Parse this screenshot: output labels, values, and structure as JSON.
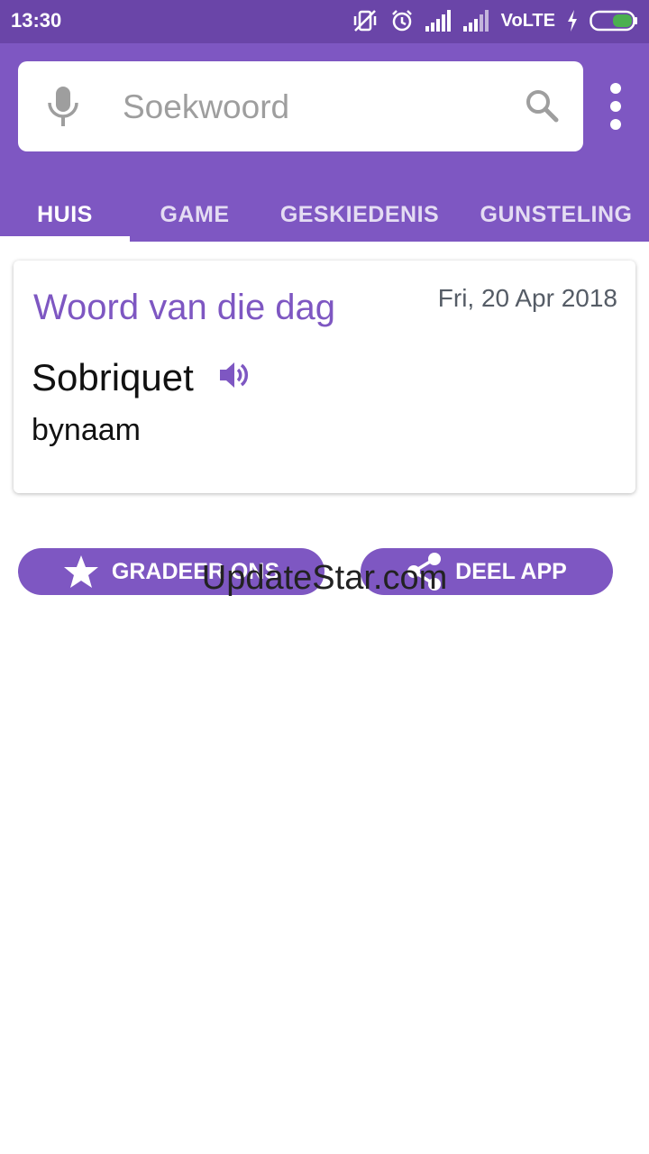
{
  "status_bar": {
    "time": "13:30",
    "network": "VoLTE"
  },
  "search": {
    "placeholder": "Soekwoord"
  },
  "tabs": [
    {
      "label": "HUIS",
      "active": true
    },
    {
      "label": "GAME",
      "active": false
    },
    {
      "label": "GESKIEDENIS",
      "active": false
    },
    {
      "label": "GUNSTELING",
      "active": false
    }
  ],
  "word_card": {
    "title": "Woord van die dag",
    "date": "Fri, 20 Apr 2018",
    "word": "Sobriquet",
    "meaning": "bynaam"
  },
  "actions": {
    "rate_label": "GRADEER ONS",
    "share_label": "DEEL APP"
  },
  "watermark": "UpdateStar.com",
  "colors": {
    "status_bar": "#6a45a8",
    "primary": "#7e57c2",
    "white": "#ffffff"
  },
  "icons": [
    "mic-icon",
    "search-icon",
    "overflow-menu-icon",
    "speaker-icon",
    "star-icon",
    "share-icon",
    "vibrate-off-icon",
    "alarm-icon",
    "signal-icon",
    "charging-icon",
    "battery-icon"
  ]
}
